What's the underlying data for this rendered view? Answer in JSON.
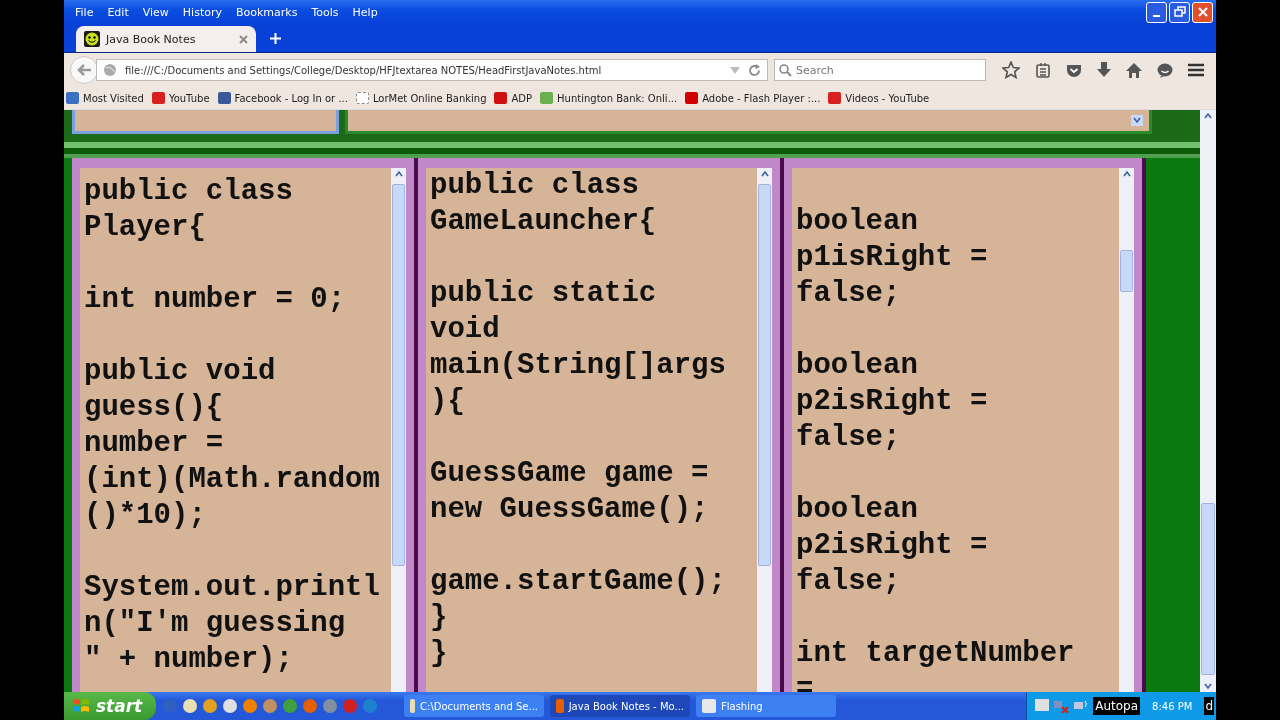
{
  "menu": [
    "File",
    "Edit",
    "View",
    "History",
    "Bookmarks",
    "Tools",
    "Help"
  ],
  "tab": {
    "title": "Java Book Notes",
    "selected": true
  },
  "address": "file:///C:/Documents and Settings/College/Desktop/HFJtextarea NOTES/HeadFirstJavaNotes.html",
  "search": {
    "placeholder": "Search"
  },
  "bookmarks": [
    {
      "label": "Most Visited",
      "kind": "folder"
    },
    {
      "label": "YouTube",
      "kind": "youtube"
    },
    {
      "label": "Facebook - Log In or ...",
      "kind": "facebook"
    },
    {
      "label": "LorMet Online Banking",
      "kind": "blank"
    },
    {
      "label": "ADP",
      "kind": "adp"
    },
    {
      "label": "Huntington Bank: Onli...",
      "kind": "bank"
    },
    {
      "label": "Adobe - Flash Player :...",
      "kind": "adobe"
    },
    {
      "label": "Videos - YouTube",
      "kind": "youtube"
    }
  ],
  "textareas": [
    {
      "blocks": [
        [
          "public class",
          "Player{"
        ],
        [
          "int number = 0;"
        ],
        [
          "public void",
          "guess(){",
          "number =",
          "(int)(Math.random",
          "()*10);"
        ],
        [
          "System.out.printl",
          "n(\"I'm guessing",
          "\" + number);"
        ]
      ]
    },
    {
      "blocks": [
        [
          "public class",
          "GameLauncher{"
        ],
        [
          "public static",
          "void",
          "main(String[]args",
          "){"
        ],
        [
          "GuessGame game =",
          "new GuessGame();"
        ],
        [
          "game.startGame();",
          "}",
          "}"
        ]
      ]
    },
    {
      "blank_top": true,
      "blocks": [
        [
          "boolean",
          "p1isRight =",
          "false;"
        ],
        [
          "boolean",
          "p2isRight =",
          "false;"
        ],
        [
          "boolean",
          "p2isRight =",
          "false;"
        ],
        [
          "int targetNumber",
          "="
        ]
      ]
    }
  ],
  "taskbar": {
    "start": "start",
    "tasks": [
      {
        "label": "C:\\Documents and Se...",
        "kind": "notepad",
        "selected": false
      },
      {
        "label": "Java Book Notes - Mo...",
        "kind": "firefox",
        "selected": true
      },
      {
        "label": "Flashing",
        "kind": "folder",
        "selected": false
      }
    ],
    "tooltip": "Autopa",
    "clock": "8:46 PM",
    "edge_text": "d"
  }
}
